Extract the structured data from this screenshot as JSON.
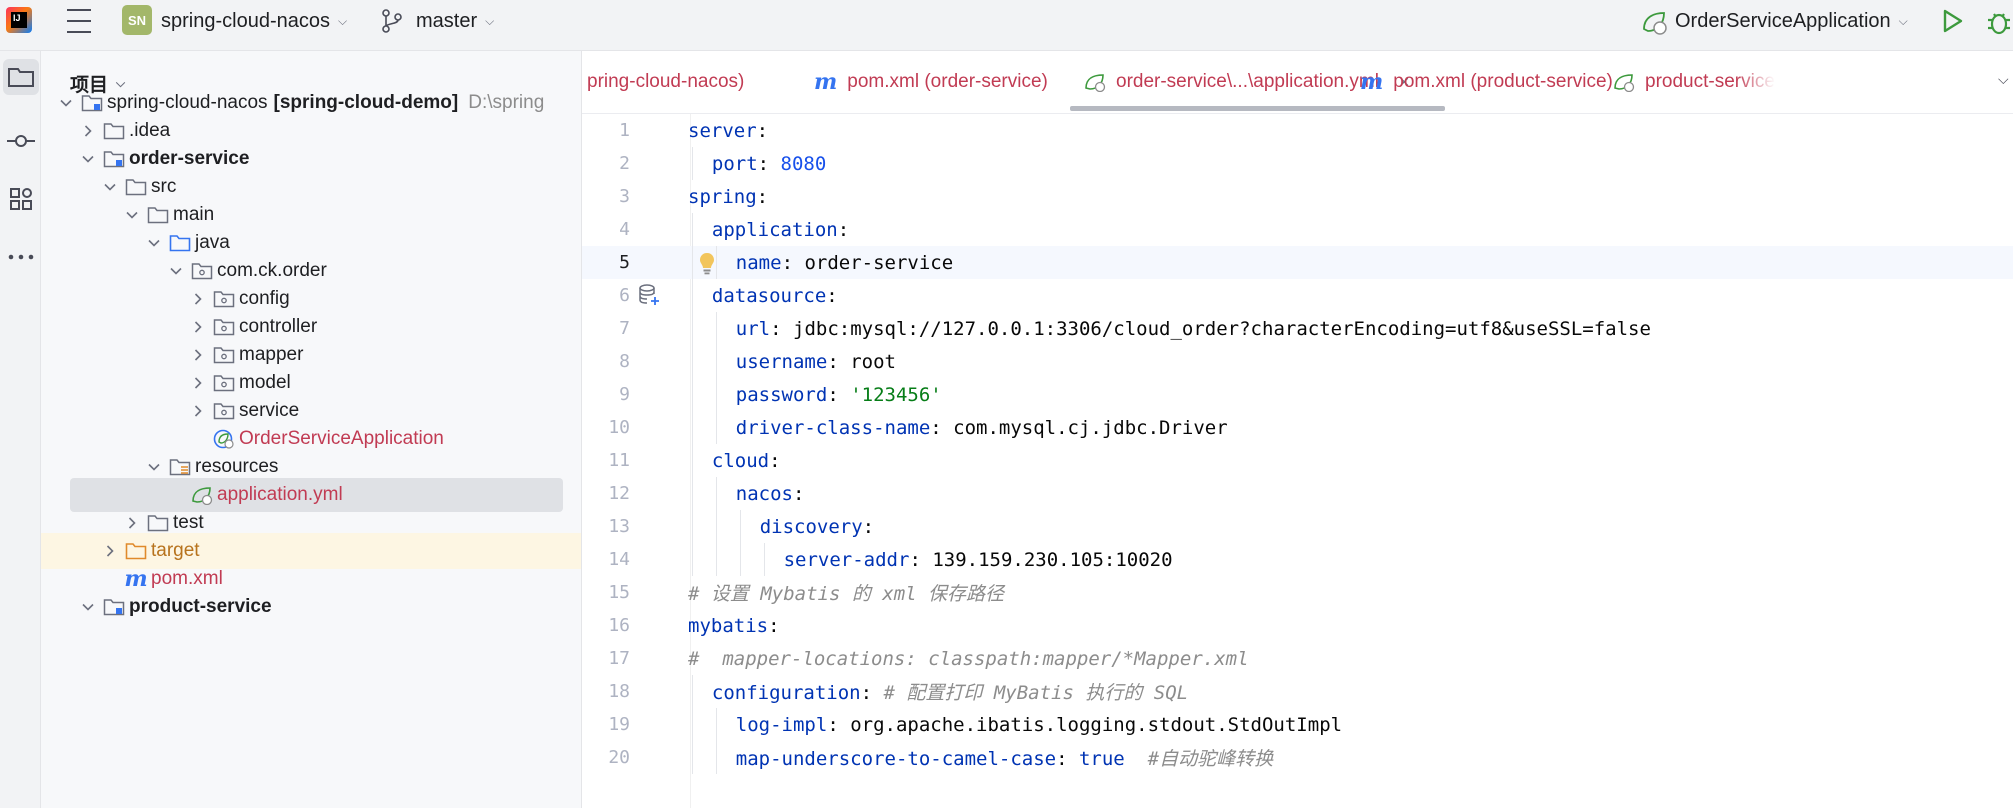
{
  "titlebar": {
    "logo_text": "IJ",
    "project_badge": "SN",
    "project_name": "spring-cloud-nacos",
    "branch": "master",
    "run_config": "OrderServiceApplication"
  },
  "colors": {
    "accent": "#3574f0",
    "badge": "#a3b76a",
    "run_green": "#3d9a3d",
    "selection": "#dfe1e5",
    "modified_red": "#c13b53"
  },
  "project_panel": {
    "title": "项目",
    "tree": [
      {
        "label": "spring-cloud-nacos",
        "extra": "[spring-cloud-demo]",
        "path": "D:\\spring",
        "icon": "module-folder-icon",
        "arrow": "expanded",
        "level": 0,
        "bold": false
      },
      {
        "label": ".idea",
        "icon": "folder-icon",
        "arrow": "collapsed",
        "level": 1
      },
      {
        "label": "order-service",
        "icon": "module-folder-icon",
        "arrow": "expanded",
        "level": 1,
        "bold": true
      },
      {
        "label": "src",
        "icon": "folder-icon",
        "arrow": "expanded",
        "level": 2
      },
      {
        "label": "main",
        "icon": "folder-icon",
        "arrow": "expanded",
        "level": 3
      },
      {
        "label": "java",
        "icon": "source-folder-icon",
        "arrow": "expanded",
        "level": 4
      },
      {
        "label": "com.ck.order",
        "icon": "package-icon",
        "arrow": "expanded",
        "level": 5
      },
      {
        "label": "config",
        "icon": "package-icon",
        "arrow": "collapsed",
        "level": 6
      },
      {
        "label": "controller",
        "icon": "package-icon",
        "arrow": "collapsed",
        "level": 6
      },
      {
        "label": "mapper",
        "icon": "package-icon",
        "arrow": "collapsed",
        "level": 6
      },
      {
        "label": "model",
        "icon": "package-icon",
        "arrow": "collapsed",
        "level": 6
      },
      {
        "label": "service",
        "icon": "package-icon",
        "arrow": "collapsed",
        "level": 6
      },
      {
        "label": "OrderServiceApplication",
        "icon": "spring-boot-class-icon",
        "arrow": "none",
        "level": 6,
        "color": "red"
      },
      {
        "label": "resources",
        "icon": "resources-folder-icon",
        "arrow": "expanded",
        "level": 4
      },
      {
        "label": "application.yml",
        "icon": "spring-yaml-icon",
        "arrow": "none",
        "level": 5,
        "color": "red",
        "selected": true
      },
      {
        "label": "test",
        "icon": "folder-icon",
        "arrow": "collapsed",
        "level": 3
      },
      {
        "label": "target",
        "icon": "excluded-folder-icon",
        "arrow": "collapsed",
        "level": 2,
        "color": "orange",
        "highlight": true
      },
      {
        "label": "pom.xml",
        "icon": "maven-icon",
        "arrow": "none",
        "level": 2,
        "color": "red"
      },
      {
        "label": "product-service",
        "icon": "module-folder-icon",
        "arrow": "expanded",
        "level": 1,
        "bold": true
      }
    ]
  },
  "tabs": [
    {
      "label": "pring-cloud-nacos)",
      "icon": "none"
    },
    {
      "label": "pom.xml (order-service)",
      "icon": "maven-icon"
    },
    {
      "label": "order-service\\...\\application.yml",
      "icon": "spring-yaml-icon",
      "active": true
    },
    {
      "label": "pom.xml (product-service)",
      "icon": "maven-icon"
    },
    {
      "label": "product-service",
      "icon": "spring-yaml-icon"
    }
  ],
  "tab_close": "×",
  "editor": {
    "current_line": 5,
    "lines": [
      {
        "n": "1",
        "indent": 0,
        "parts": [
          [
            "key",
            "server"
          ],
          [
            "plain",
            ":"
          ]
        ]
      },
      {
        "n": "2",
        "indent": 1,
        "parts": [
          [
            "key",
            "port"
          ],
          [
            "plain",
            ": "
          ],
          [
            "num",
            "8080"
          ]
        ]
      },
      {
        "n": "3",
        "indent": 0,
        "parts": [
          [
            "key",
            "spring"
          ],
          [
            "plain",
            ":"
          ]
        ]
      },
      {
        "n": "4",
        "indent": 1,
        "parts": [
          [
            "key",
            "application"
          ],
          [
            "plain",
            ":"
          ]
        ]
      },
      {
        "n": "5",
        "indent": 2,
        "parts": [
          [
            "key",
            "name"
          ],
          [
            "plain",
            ": order-service"
          ]
        ]
      },
      {
        "n": "6",
        "indent": 1,
        "parts": [
          [
            "key",
            "datasource"
          ],
          [
            "plain",
            ":"
          ]
        ]
      },
      {
        "n": "7",
        "indent": 2,
        "parts": [
          [
            "key",
            "url"
          ],
          [
            "plain",
            ": jdbc:mysql://127.0.0.1:3306/cloud_order?characterEncoding=utf8&useSSL=false"
          ]
        ]
      },
      {
        "n": "8",
        "indent": 2,
        "parts": [
          [
            "key",
            "username"
          ],
          [
            "plain",
            ": root"
          ]
        ]
      },
      {
        "n": "9",
        "indent": 2,
        "parts": [
          [
            "key",
            "password"
          ],
          [
            "plain",
            ": "
          ],
          [
            "str",
            "'123456'"
          ]
        ]
      },
      {
        "n": "10",
        "indent": 2,
        "parts": [
          [
            "key",
            "driver-class-name"
          ],
          [
            "plain",
            ": com.mysql.cj.jdbc.Driver"
          ]
        ]
      },
      {
        "n": "11",
        "indent": 1,
        "parts": [
          [
            "key",
            "cloud"
          ],
          [
            "plain",
            ":"
          ]
        ]
      },
      {
        "n": "12",
        "indent": 2,
        "parts": [
          [
            "key",
            "nacos"
          ],
          [
            "plain",
            ":"
          ]
        ]
      },
      {
        "n": "13",
        "indent": 3,
        "parts": [
          [
            "key",
            "discovery"
          ],
          [
            "plain",
            ":"
          ]
        ]
      },
      {
        "n": "14",
        "indent": 4,
        "parts": [
          [
            "key",
            "server-addr"
          ],
          [
            "plain",
            ": 139.159.230.105:10020"
          ]
        ]
      },
      {
        "n": "15",
        "indent": 0,
        "parts": [
          [
            "cmt",
            "# 设置 Mybatis 的 xml 保存路径"
          ]
        ]
      },
      {
        "n": "16",
        "indent": 0,
        "parts": [
          [
            "key",
            "mybatis"
          ],
          [
            "plain",
            ":"
          ]
        ]
      },
      {
        "n": "17",
        "indent": 0,
        "parts": [
          [
            "cmt",
            "#  mapper-locations: classpath:mapper/*Mapper.xml"
          ]
        ]
      },
      {
        "n": "18",
        "indent": 1,
        "parts": [
          [
            "key",
            "configuration"
          ],
          [
            "plain",
            ": "
          ],
          [
            "cmt",
            "# 配置打印 MyBatis 执行的 SQL"
          ]
        ]
      },
      {
        "n": "19",
        "indent": 2,
        "parts": [
          [
            "key",
            "log-impl"
          ],
          [
            "plain",
            ": org.apache.ibatis.logging.stdout.StdOutImpl"
          ]
        ]
      },
      {
        "n": "20",
        "indent": 2,
        "parts": [
          [
            "key",
            "map-underscore-to-camel-case"
          ],
          [
            "plain",
            ": "
          ],
          [
            "key",
            "true"
          ],
          [
            "plain",
            "  "
          ],
          [
            "cmt",
            "#自动驼峰转换"
          ]
        ]
      }
    ]
  }
}
